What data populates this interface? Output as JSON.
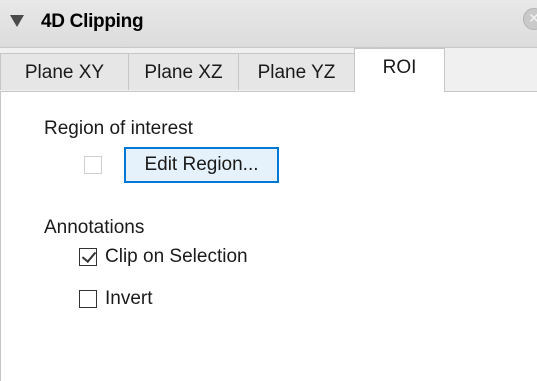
{
  "panel": {
    "title": "4D Clipping",
    "close_symbol": "✕",
    "icons": {
      "collapse": "triangle-down-icon",
      "close": "close-icon"
    }
  },
  "tabs": [
    {
      "label": "Plane XY",
      "active": false
    },
    {
      "label": "Plane XZ",
      "active": false
    },
    {
      "label": "Plane YZ",
      "active": false
    },
    {
      "label": "ROI",
      "active": true
    }
  ],
  "roi": {
    "region_heading": "Region of interest",
    "region_checkbox_checked": false,
    "region_checkbox_enabled": false,
    "edit_region_label": "Edit Region...",
    "annotations_heading": "Annotations",
    "clip_on_selection_label": "Clip on Selection",
    "clip_on_selection_checked": true,
    "invert_label": "Invert",
    "invert_checked": false
  },
  "colors": {
    "button_border": "#0078d7",
    "button_fill": "#e5f1fb",
    "header_bg": "#dcdcdc"
  }
}
